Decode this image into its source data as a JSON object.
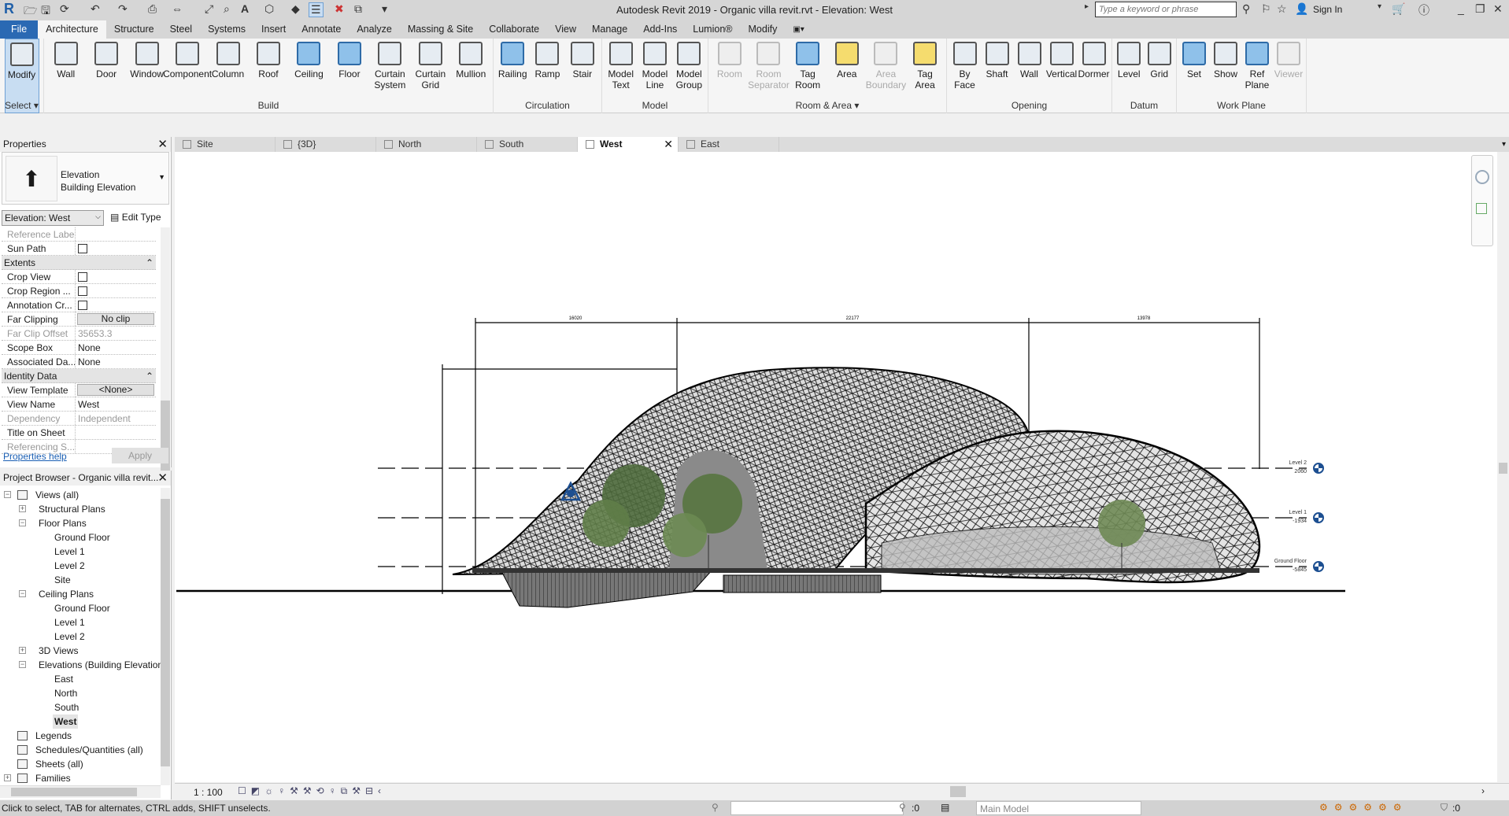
{
  "app": {
    "title": "Autodesk Revit 2019 - Organic villa revit.rvt - Elevation: West",
    "logo": "R",
    "search_placeholder": "Type a keyword or phrase",
    "sign_in": "Sign In"
  },
  "ribbon_tabs": [
    "File",
    "Architecture",
    "Structure",
    "Steel",
    "Systems",
    "Insert",
    "Annotate",
    "Analyze",
    "Massing & Site",
    "Collaborate",
    "View",
    "Manage",
    "Add-Ins",
    "Lumion®",
    "Modify"
  ],
  "active_tab": "Architecture",
  "ribbon_groups": [
    {
      "label": "Select ▾",
      "buttons": [
        {
          "label": "Modify",
          "state": "selected",
          "icon": "cursor-icon"
        }
      ]
    },
    {
      "label": "Build",
      "buttons": [
        {
          "label": "Wall",
          "icon": "wall-icon"
        },
        {
          "label": "Door",
          "icon": "door-icon"
        },
        {
          "label": "Window",
          "icon": "window-icon"
        },
        {
          "label": "Component",
          "icon": "component-icon"
        },
        {
          "label": "Column",
          "icon": "column-icon"
        },
        {
          "label": "Roof",
          "icon": "roof-icon"
        },
        {
          "label": "Ceiling",
          "icon": "ceiling-icon",
          "color": "blue"
        },
        {
          "label": "Floor",
          "icon": "floor-icon",
          "color": "blue"
        },
        {
          "label": "Curtain System",
          "icon": "curtain-system-icon"
        },
        {
          "label": "Curtain Grid",
          "icon": "curtain-grid-icon"
        },
        {
          "label": "Mullion",
          "icon": "mullion-icon"
        }
      ]
    },
    {
      "label": "Circulation",
      "buttons": [
        {
          "label": "Railing",
          "icon": "railing-icon",
          "color": "blue"
        },
        {
          "label": "Ramp",
          "icon": "ramp-icon"
        },
        {
          "label": "Stair",
          "icon": "stair-icon"
        }
      ]
    },
    {
      "label": "Model",
      "buttons": [
        {
          "label": "Model Text",
          "icon": "model-text-icon"
        },
        {
          "label": "Model Line",
          "icon": "model-line-icon"
        },
        {
          "label": "Model Group",
          "icon": "model-group-icon"
        }
      ]
    },
    {
      "label": "Room & Area ▾",
      "buttons": [
        {
          "label": "Room",
          "icon": "room-icon",
          "state": "disabled"
        },
        {
          "label": "Room Separator",
          "icon": "room-separator-icon",
          "state": "disabled"
        },
        {
          "label": "Tag Room",
          "icon": "tag-room-icon",
          "color": "blue"
        },
        {
          "label": "Area",
          "icon": "area-icon",
          "color": "yellow"
        },
        {
          "label": "Area Boundary",
          "icon": "area-boundary-icon",
          "state": "disabled"
        },
        {
          "label": "Tag Area",
          "icon": "tag-area-icon",
          "color": "yellow"
        }
      ]
    },
    {
      "label": "Opening",
      "buttons": [
        {
          "label": "By Face",
          "icon": "by-face-icon"
        },
        {
          "label": "Shaft",
          "icon": "shaft-icon"
        },
        {
          "label": "Wall",
          "icon": "wall-opening-icon"
        },
        {
          "label": "Vertical",
          "icon": "vertical-icon"
        },
        {
          "label": "Dormer",
          "icon": "dormer-icon"
        }
      ]
    },
    {
      "label": "Datum",
      "buttons": [
        {
          "label": "Level",
          "icon": "level-icon"
        },
        {
          "label": "Grid",
          "icon": "grid-icon"
        }
      ]
    },
    {
      "label": "Work Plane",
      "buttons": [
        {
          "label": "Set",
          "icon": "set-icon",
          "color": "blue"
        },
        {
          "label": "Show",
          "icon": "show-icon"
        },
        {
          "label": "Ref Plane",
          "icon": "ref-plane-icon",
          "color": "blue"
        },
        {
          "label": "Viewer",
          "icon": "viewer-icon",
          "state": "disabled"
        }
      ]
    }
  ],
  "properties": {
    "title": "Properties",
    "type_line1": "Elevation",
    "type_line2": "Building Elevation",
    "view_selector": "Elevation: West",
    "edit_type": "Edit Type",
    "rows": [
      {
        "label": "Reference Label",
        "value": "",
        "kind": "grey"
      },
      {
        "label": "Sun Path",
        "kind": "check"
      },
      {
        "header": "Extents"
      },
      {
        "label": "Crop View",
        "kind": "check"
      },
      {
        "label": "Crop Region ...",
        "kind": "check"
      },
      {
        "label": "Annotation Cr...",
        "kind": "check"
      },
      {
        "label": "Far Clipping",
        "value": "No clip",
        "kind": "button"
      },
      {
        "label": "Far Clip Offset",
        "value": "35653.3",
        "kind": "grey"
      },
      {
        "label": "Scope Box",
        "value": "None"
      },
      {
        "label": "Associated Da...",
        "value": "None"
      },
      {
        "header": "Identity Data"
      },
      {
        "label": "View Template",
        "value": "<None>",
        "kind": "button"
      },
      {
        "label": "View Name",
        "value": "West"
      },
      {
        "label": "Dependency",
        "value": "Independent",
        "kind": "grey"
      },
      {
        "label": "Title on Sheet",
        "value": ""
      },
      {
        "label": "Referencing S...",
        "value": "",
        "kind": "grey"
      }
    ],
    "help": "Properties help",
    "apply": "Apply"
  },
  "browser": {
    "title": "Project Browser - Organic villa revit...",
    "items": [
      {
        "label": "Views (all)",
        "level": 0,
        "exp": "-",
        "icon": true
      },
      {
        "label": "Structural Plans",
        "level": 1,
        "exp": "+"
      },
      {
        "label": "Floor Plans",
        "level": 1,
        "exp": "-"
      },
      {
        "label": "Ground Floor",
        "level": 2
      },
      {
        "label": "Level 1",
        "level": 2
      },
      {
        "label": "Level 2",
        "level": 2
      },
      {
        "label": "Site",
        "level": 2
      },
      {
        "label": "Ceiling Plans",
        "level": 1,
        "exp": "-"
      },
      {
        "label": "Ground Floor",
        "level": 2
      },
      {
        "label": "Level 1",
        "level": 2
      },
      {
        "label": "Level 2",
        "level": 2
      },
      {
        "label": "3D Views",
        "level": 1,
        "exp": "+"
      },
      {
        "label": "Elevations (Building Elevation)",
        "level": 1,
        "exp": "-"
      },
      {
        "label": "East",
        "level": 2
      },
      {
        "label": "North",
        "level": 2
      },
      {
        "label": "South",
        "level": 2
      },
      {
        "label": "West",
        "level": 2,
        "selected": true
      },
      {
        "label": "Legends",
        "level": 0,
        "icon": true
      },
      {
        "label": "Schedules/Quantities (all)",
        "level": 0,
        "icon": true
      },
      {
        "label": "Sheets (all)",
        "level": 0,
        "icon": true
      },
      {
        "label": "Families",
        "level": 0,
        "exp": "+",
        "icon": true
      }
    ]
  },
  "view_tabs": [
    {
      "label": "Site"
    },
    {
      "label": "{3D}"
    },
    {
      "label": "North"
    },
    {
      "label": "South"
    },
    {
      "label": "West",
      "active": true
    },
    {
      "label": "East"
    }
  ],
  "drawing": {
    "dimensions": [
      "16020",
      "22177",
      "13978"
    ],
    "levels": [
      {
        "name": "Level 2",
        "elevation": "2060"
      },
      {
        "name": "Level 1",
        "elevation": "-1934"
      },
      {
        "name": "Ground Floor",
        "elevation": "-5845"
      }
    ],
    "level_head_color": "#1d4f91"
  },
  "view_bar": {
    "scale": "1 : 100"
  },
  "status": {
    "message": "Click to select, TAB for alternates, CTRL adds, SHIFT unselects.",
    "worksets_count": ":0",
    "design_option": "Main Model",
    "filter_count": ":0"
  }
}
